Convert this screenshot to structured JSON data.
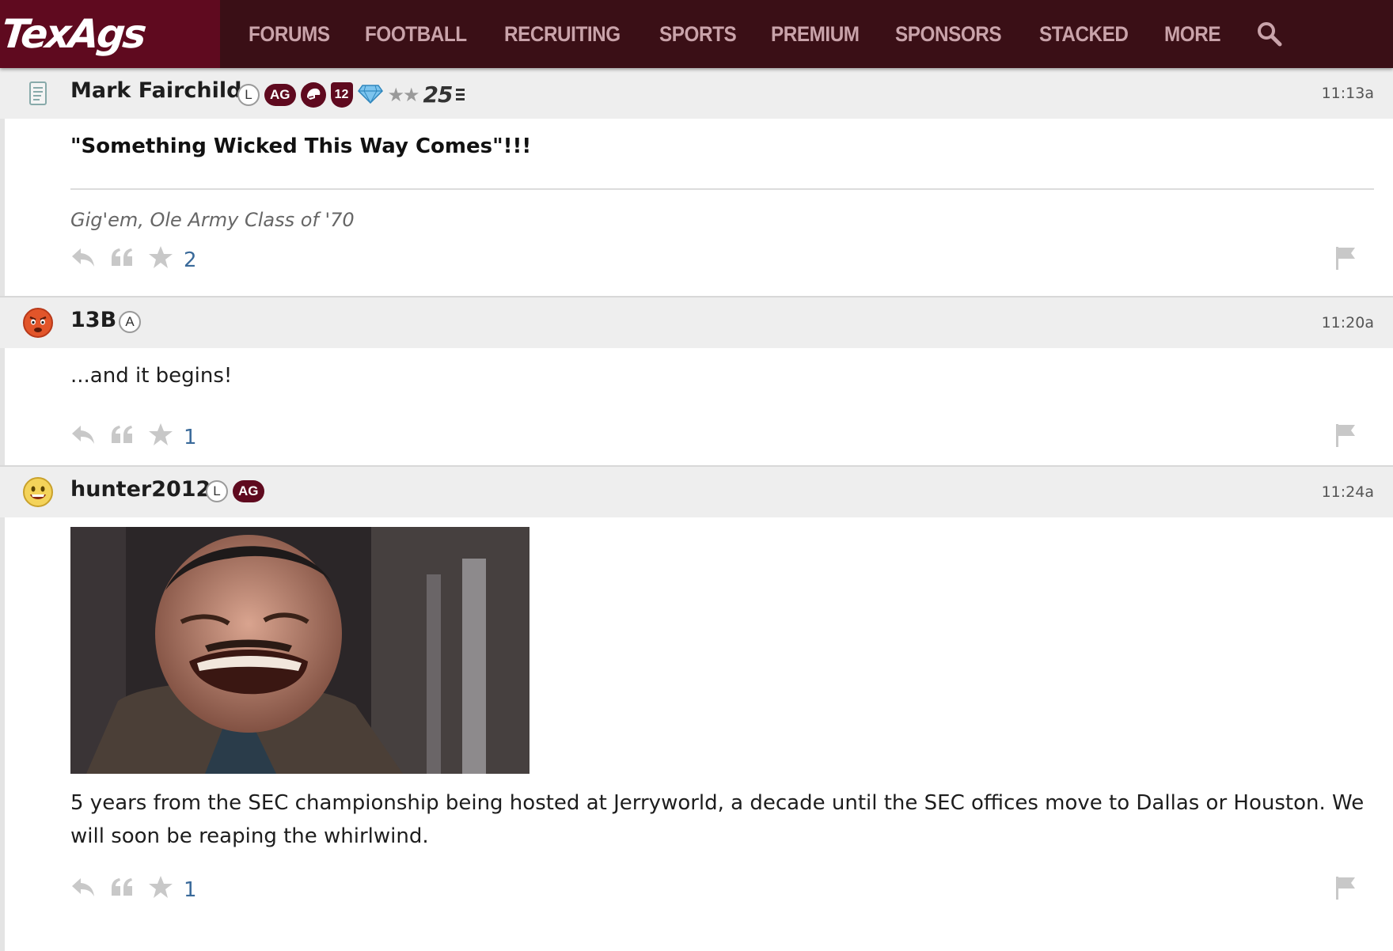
{
  "site": {
    "logo": "TexAgs"
  },
  "nav": {
    "items": [
      "FORUMS",
      "FOOTBALL",
      "RECRUITING",
      "SPORTS",
      "PREMIUM",
      "SPONSORS",
      "STACKED",
      "MORE"
    ],
    "search_icon": "search-icon"
  },
  "posts": [
    {
      "username": "Mark Fairchild",
      "avatar_icon": "notepad-icon",
      "badges": {
        "letter": "L",
        "ag": "AG",
        "twelve": "12",
        "stars": "★★",
        "rank": "25"
      },
      "time": "11:13a",
      "title": "\"Something Wicked This Way Comes\"!!!",
      "signature": "Gig'em, Ole Army Class of '70",
      "star_count": "2"
    },
    {
      "username": "13B",
      "avatar_icon": "angry-face-icon",
      "badges": {
        "letter": "A"
      },
      "time": "11:20a",
      "text": "...and it begins!",
      "star_count": "1"
    },
    {
      "username": "hunter2012",
      "avatar_icon": "smiley-face-icon",
      "badges": {
        "letter": "L",
        "ag": "AG"
      },
      "time": "11:24a",
      "image": "laughing-man-gif",
      "text": "5 years from the SEC championship being hosted at Jerryworld, a decade until the SEC offices move to Dallas or Houston. We will soon be reaping the whirlwind.",
      "star_count": "1"
    }
  ],
  "colors": {
    "maroon": "#5f0a1f",
    "nav_bg": "#3a0f16",
    "nav_text": "#c9a3aa",
    "header_gray": "#eeeeee",
    "star_count_blue": "#3a6a9a"
  }
}
